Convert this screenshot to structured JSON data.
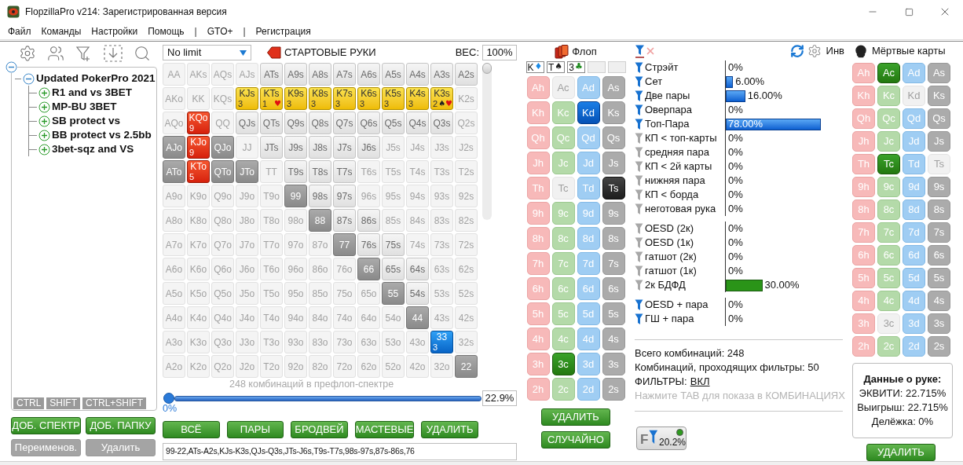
{
  "window": {
    "title": "FlopzillaPro v214: Зарегистрированная версия"
  },
  "menu": [
    {
      "label": "Файл",
      "kind": "item"
    },
    {
      "label": "Команды",
      "kind": "item"
    },
    {
      "label": "Настройки",
      "kind": "item"
    },
    {
      "label": "Помощь",
      "kind": "item"
    },
    {
      "label": "|",
      "kind": "separator"
    },
    {
      "label": "GTO+",
      "kind": "item"
    },
    {
      "label": "|",
      "kind": "separator"
    },
    {
      "label": "Регистрация",
      "kind": "item"
    }
  ],
  "tree": {
    "expanded": true,
    "children": [
      {
        "label": "Updated PokerPro 2021",
        "expanded": true,
        "children": [
          {
            "label": "R1 and vs 3BET",
            "expanded": false
          },
          {
            "label": "MP-BU 3BET",
            "expanded": false
          },
          {
            "label": "SB protect vs",
            "expanded": false
          },
          {
            "label": "BB protect vs 2.5bb",
            "expanded": false
          },
          {
            "label": "3bet-sqz and VS",
            "expanded": false
          }
        ]
      }
    ]
  },
  "modifier_tabs": [
    "CTRL",
    "SHIFT",
    "CTRL+SHIFT"
  ],
  "range_buttons": [
    {
      "label": "ДОБ. СПЕКТР",
      "disabled": false
    },
    {
      "label": "ДОБ. ПАПКУ",
      "disabled": false
    },
    {
      "label": "Переименов.",
      "disabled": true
    },
    {
      "label": "Удалить",
      "disabled": true
    }
  ],
  "range_editor": {
    "game": "No limit",
    "title": "СТАРТОВЫЕ РУКИ",
    "weight_label": "ВЕС:",
    "weight": "100%",
    "matrix": [
      [
        {
          "label": "AA",
          "kind": "off"
        },
        {
          "label": "AKs",
          "kind": "off"
        },
        {
          "label": "AQs",
          "kind": "off"
        },
        {
          "label": "AJs",
          "kind": "off"
        },
        {
          "label": "ATs",
          "kind": "on"
        },
        {
          "label": "A9s",
          "kind": "on"
        },
        {
          "label": "A8s",
          "kind": "on"
        },
        {
          "label": "A7s",
          "kind": "on"
        },
        {
          "label": "A6s",
          "kind": "on"
        },
        {
          "label": "A5s",
          "kind": "on"
        },
        {
          "label": "A4s",
          "kind": "on"
        },
        {
          "label": "A3s",
          "kind": "on"
        },
        {
          "label": "A2s",
          "kind": "on"
        }
      ],
      [
        {
          "label": "AKo",
          "kind": "off"
        },
        {
          "label": "KK",
          "kind": "off"
        },
        {
          "label": "KQs",
          "kind": "off"
        },
        {
          "label": "KJs",
          "kind": "yellow",
          "count": "3"
        },
        {
          "label": "KTs",
          "kind": "yellow",
          "count": "1",
          "marks": [
            {
              "symbol": "♥",
              "color": "#e01010"
            }
          ]
        },
        {
          "label": "K9s",
          "kind": "yellow",
          "count": "3"
        },
        {
          "label": "K8s",
          "kind": "yellow",
          "count": "3"
        },
        {
          "label": "K7s",
          "kind": "yellow",
          "count": "3"
        },
        {
          "label": "K6s",
          "kind": "yellow",
          "count": "3"
        },
        {
          "label": "K5s",
          "kind": "yellow",
          "count": "3"
        },
        {
          "label": "K4s",
          "kind": "yellow",
          "count": "3"
        },
        {
          "label": "K3s",
          "kind": "yellow",
          "count": "2",
          "marks": [
            {
              "symbol": "♠",
              "color": "#222222"
            },
            {
              "symbol": "♥",
              "color": "#e01010"
            }
          ]
        },
        {
          "label": "K2s",
          "kind": "off"
        }
      ],
      [
        {
          "label": "AQo",
          "kind": "off"
        },
        {
          "label": "KQo",
          "kind": "red",
          "count": "9"
        },
        {
          "label": "QQ",
          "kind": "off"
        },
        {
          "label": "QJs",
          "kind": "on"
        },
        {
          "label": "QTs",
          "kind": "on"
        },
        {
          "label": "Q9s",
          "kind": "on"
        },
        {
          "label": "Q8s",
          "kind": "on"
        },
        {
          "label": "Q7s",
          "kind": "on"
        },
        {
          "label": "Q6s",
          "kind": "on"
        },
        {
          "label": "Q5s",
          "kind": "on"
        },
        {
          "label": "Q4s",
          "kind": "on"
        },
        {
          "label": "Q3s",
          "kind": "on"
        },
        {
          "label": "Q2s",
          "kind": "off"
        }
      ],
      [
        {
          "label": "AJo",
          "kind": "dark"
        },
        {
          "label": "KJo",
          "kind": "red",
          "count": "9"
        },
        {
          "label": "QJo",
          "kind": "dark"
        },
        {
          "label": "JJ",
          "kind": "off"
        },
        {
          "label": "JTs",
          "kind": "on"
        },
        {
          "label": "J9s",
          "kind": "on"
        },
        {
          "label": "J8s",
          "kind": "on"
        },
        {
          "label": "J7s",
          "kind": "on"
        },
        {
          "label": "J6s",
          "kind": "on"
        },
        {
          "label": "J5s",
          "kind": "off"
        },
        {
          "label": "J4s",
          "kind": "off"
        },
        {
          "label": "J3s",
          "kind": "off"
        },
        {
          "label": "J2s",
          "kind": "off"
        }
      ],
      [
        {
          "label": "ATo",
          "kind": "dark"
        },
        {
          "label": "KTo",
          "kind": "red",
          "count": "5"
        },
        {
          "label": "QTo",
          "kind": "dark"
        },
        {
          "label": "JTo",
          "kind": "dark"
        },
        {
          "label": "TT",
          "kind": "off"
        },
        {
          "label": "T9s",
          "kind": "on"
        },
        {
          "label": "T8s",
          "kind": "on"
        },
        {
          "label": "T7s",
          "kind": "on"
        },
        {
          "label": "T6s",
          "kind": "off"
        },
        {
          "label": "T5s",
          "kind": "off"
        },
        {
          "label": "T4s",
          "kind": "off"
        },
        {
          "label": "T3s",
          "kind": "off"
        },
        {
          "label": "T2s",
          "kind": "off"
        }
      ],
      [
        {
          "label": "A9o",
          "kind": "off"
        },
        {
          "label": "K9o",
          "kind": "off"
        },
        {
          "label": "Q9o",
          "kind": "off"
        },
        {
          "label": "J9o",
          "kind": "off"
        },
        {
          "label": "T9o",
          "kind": "off"
        },
        {
          "label": "99",
          "kind": "dark"
        },
        {
          "label": "98s",
          "kind": "on"
        },
        {
          "label": "97s",
          "kind": "on"
        },
        {
          "label": "96s",
          "kind": "off"
        },
        {
          "label": "95s",
          "kind": "off"
        },
        {
          "label": "94s",
          "kind": "off"
        },
        {
          "label": "93s",
          "kind": "off"
        },
        {
          "label": "92s",
          "kind": "off"
        }
      ],
      [
        {
          "label": "A8o",
          "kind": "off"
        },
        {
          "label": "K8o",
          "kind": "off"
        },
        {
          "label": "Q8o",
          "kind": "off"
        },
        {
          "label": "J8o",
          "kind": "off"
        },
        {
          "label": "T8o",
          "kind": "off"
        },
        {
          "label": "98o",
          "kind": "off"
        },
        {
          "label": "88",
          "kind": "dark"
        },
        {
          "label": "87s",
          "kind": "on"
        },
        {
          "label": "86s",
          "kind": "on"
        },
        {
          "label": "85s",
          "kind": "off"
        },
        {
          "label": "84s",
          "kind": "off"
        },
        {
          "label": "83s",
          "kind": "off"
        },
        {
          "label": "82s",
          "kind": "off"
        }
      ],
      [
        {
          "label": "A7o",
          "kind": "off"
        },
        {
          "label": "K7o",
          "kind": "off"
        },
        {
          "label": "Q7o",
          "kind": "off"
        },
        {
          "label": "J7o",
          "kind": "off"
        },
        {
          "label": "T7o",
          "kind": "off"
        },
        {
          "label": "97o",
          "kind": "off"
        },
        {
          "label": "87o",
          "kind": "off"
        },
        {
          "label": "77",
          "kind": "dark"
        },
        {
          "label": "76s",
          "kind": "on"
        },
        {
          "label": "75s",
          "kind": "on"
        },
        {
          "label": "74s",
          "kind": "off"
        },
        {
          "label": "73s",
          "kind": "off"
        },
        {
          "label": "72s",
          "kind": "off"
        }
      ],
      [
        {
          "label": "A6o",
          "kind": "off"
        },
        {
          "label": "K6o",
          "kind": "off"
        },
        {
          "label": "Q6o",
          "kind": "off"
        },
        {
          "label": "J6o",
          "kind": "off"
        },
        {
          "label": "T6o",
          "kind": "off"
        },
        {
          "label": "96o",
          "kind": "off"
        },
        {
          "label": "86o",
          "kind": "off"
        },
        {
          "label": "76o",
          "kind": "off"
        },
        {
          "label": "66",
          "kind": "dark"
        },
        {
          "label": "65s",
          "kind": "on"
        },
        {
          "label": "64s",
          "kind": "on"
        },
        {
          "label": "63s",
          "kind": "off"
        },
        {
          "label": "62s",
          "kind": "off"
        }
      ],
      [
        {
          "label": "A5o",
          "kind": "off"
        },
        {
          "label": "K5o",
          "kind": "off"
        },
        {
          "label": "Q5o",
          "kind": "off"
        },
        {
          "label": "J5o",
          "kind": "off"
        },
        {
          "label": "T5o",
          "kind": "off"
        },
        {
          "label": "95o",
          "kind": "off"
        },
        {
          "label": "85o",
          "kind": "off"
        },
        {
          "label": "75o",
          "kind": "off"
        },
        {
          "label": "65o",
          "kind": "off"
        },
        {
          "label": "55",
          "kind": "dark"
        },
        {
          "label": "54s",
          "kind": "on"
        },
        {
          "label": "53s",
          "kind": "off"
        },
        {
          "label": "52s",
          "kind": "off"
        }
      ],
      [
        {
          "label": "A4o",
          "kind": "off"
        },
        {
          "label": "K4o",
          "kind": "off"
        },
        {
          "label": "Q4o",
          "kind": "off"
        },
        {
          "label": "J4o",
          "kind": "off"
        },
        {
          "label": "T4o",
          "kind": "off"
        },
        {
          "label": "94o",
          "kind": "off"
        },
        {
          "label": "84o",
          "kind": "off"
        },
        {
          "label": "74o",
          "kind": "off"
        },
        {
          "label": "64o",
          "kind": "off"
        },
        {
          "label": "54o",
          "kind": "off"
        },
        {
          "label": "44",
          "kind": "dark"
        },
        {
          "label": "43s",
          "kind": "off"
        },
        {
          "label": "42s",
          "kind": "off"
        }
      ],
      [
        {
          "label": "A3o",
          "kind": "off"
        },
        {
          "label": "K3o",
          "kind": "off"
        },
        {
          "label": "Q3o",
          "kind": "off"
        },
        {
          "label": "J3o",
          "kind": "off"
        },
        {
          "label": "T3o",
          "kind": "off"
        },
        {
          "label": "93o",
          "kind": "off"
        },
        {
          "label": "83o",
          "kind": "off"
        },
        {
          "label": "73o",
          "kind": "off"
        },
        {
          "label": "63o",
          "kind": "off"
        },
        {
          "label": "53o",
          "kind": "off"
        },
        {
          "label": "43o",
          "kind": "off"
        },
        {
          "label": "33",
          "kind": "blue",
          "count": "3"
        },
        {
          "label": "32s",
          "kind": "off"
        }
      ],
      [
        {
          "label": "A2o",
          "kind": "off"
        },
        {
          "label": "K2o",
          "kind": "off"
        },
        {
          "label": "Q2o",
          "kind": "off"
        },
        {
          "label": "J2o",
          "kind": "off"
        },
        {
          "label": "T2o",
          "kind": "off"
        },
        {
          "label": "92o",
          "kind": "off"
        },
        {
          "label": "82o",
          "kind": "off"
        },
        {
          "label": "72o",
          "kind": "off"
        },
        {
          "label": "62o",
          "kind": "off"
        },
        {
          "label": "52o",
          "kind": "off"
        },
        {
          "label": "42o",
          "kind": "off"
        },
        {
          "label": "32o",
          "kind": "off"
        },
        {
          "label": "22",
          "kind": "dark"
        }
      ]
    ],
    "weight_slider": {
      "level": 1
    },
    "range_slider": {
      "level": 0
    },
    "combos_caption": "248 комбинаций в префлоп-спектре",
    "slider_min": "0%",
    "slider_value": "22.9%",
    "buttons": [
      "ВСЁ",
      "ПАРЫ",
      "БРОДВЕЙ",
      "МАСТЕВЫЕ",
      "УДАЛИТЬ"
    ],
    "range_text": "99-22,ATs-A2s,KJs-K3s,QJs-Q3s,JTs-J6s,T9s-T7s,98s-97s,87s-86s,76"
  },
  "flop": {
    "title": "Флоп",
    "board": [
      {
        "kind": "card",
        "rank": "K",
        "suit": "♦",
        "color": "#1a8ae6"
      },
      {
        "kind": "card",
        "rank": "T",
        "suit": "♠",
        "color": "#222222"
      },
      {
        "kind": "card",
        "rank": "3",
        "suit": "♣",
        "color": "#1e8a1e"
      },
      {
        "kind": "empty"
      },
      {
        "kind": "empty"
      }
    ],
    "cards": [
      [
        {
          "label": "Ah",
          "selected": false,
          "disabled": false
        },
        {
          "label": "Ac",
          "selected": false,
          "disabled": true
        },
        {
          "label": "Ad",
          "selected": false,
          "disabled": false
        },
        {
          "label": "As",
          "selected": false,
          "disabled": false
        }
      ],
      [
        {
          "label": "Kh",
          "selected": false,
          "disabled": false
        },
        {
          "label": "Kc",
          "selected": false,
          "disabled": false
        },
        {
          "label": "Kd",
          "selected": true,
          "disabled": false
        },
        {
          "label": "Ks",
          "selected": false,
          "disabled": false
        }
      ],
      [
        {
          "label": "Qh",
          "selected": false,
          "disabled": false
        },
        {
          "label": "Qc",
          "selected": false,
          "disabled": false
        },
        {
          "label": "Qd",
          "selected": false,
          "disabled": false
        },
        {
          "label": "Qs",
          "selected": false,
          "disabled": false
        }
      ],
      [
        {
          "label": "Jh",
          "selected": false,
          "disabled": false
        },
        {
          "label": "Jc",
          "selected": false,
          "disabled": false
        },
        {
          "label": "Jd",
          "selected": false,
          "disabled": false
        },
        {
          "label": "Js",
          "selected": false,
          "disabled": false
        }
      ],
      [
        {
          "label": "Th",
          "selected": false,
          "disabled": false
        },
        {
          "label": "Tc",
          "selected": false,
          "disabled": true
        },
        {
          "label": "Td",
          "selected": false,
          "disabled": false
        },
        {
          "label": "Ts",
          "selected": true,
          "disabled": false
        }
      ],
      [
        {
          "label": "9h",
          "selected": false,
          "disabled": false
        },
        {
          "label": "9c",
          "selected": false,
          "disabled": false
        },
        {
          "label": "9d",
          "selected": false,
          "disabled": false
        },
        {
          "label": "9s",
          "selected": false,
          "disabled": false
        }
      ],
      [
        {
          "label": "8h",
          "selected": false,
          "disabled": false
        },
        {
          "label": "8c",
          "selected": false,
          "disabled": false
        },
        {
          "label": "8d",
          "selected": false,
          "disabled": false
        },
        {
          "label": "8s",
          "selected": false,
          "disabled": false
        }
      ],
      [
        {
          "label": "7h",
          "selected": false,
          "disabled": false
        },
        {
          "label": "7c",
          "selected": false,
          "disabled": false
        },
        {
          "label": "7d",
          "selected": false,
          "disabled": false
        },
        {
          "label": "7s",
          "selected": false,
          "disabled": false
        }
      ],
      [
        {
          "label": "6h",
          "selected": false,
          "disabled": false
        },
        {
          "label": "6c",
          "selected": false,
          "disabled": false
        },
        {
          "label": "6d",
          "selected": false,
          "disabled": false
        },
        {
          "label": "6s",
          "selected": false,
          "disabled": false
        }
      ],
      [
        {
          "label": "5h",
          "selected": false,
          "disabled": false
        },
        {
          "label": "5c",
          "selected": false,
          "disabled": false
        },
        {
          "label": "5d",
          "selected": false,
          "disabled": false
        },
        {
          "label": "5s",
          "selected": false,
          "disabled": false
        }
      ],
      [
        {
          "label": "4h",
          "selected": false,
          "disabled": false
        },
        {
          "label": "4c",
          "selected": false,
          "disabled": false
        },
        {
          "label": "4d",
          "selected": false,
          "disabled": false
        },
        {
          "label": "4s",
          "selected": false,
          "disabled": false
        }
      ],
      [
        {
          "label": "3h",
          "selected": false,
          "disabled": false
        },
        {
          "label": "3c",
          "selected": true,
          "disabled": false
        },
        {
          "label": "3d",
          "selected": false,
          "disabled": false
        },
        {
          "label": "3s",
          "selected": false,
          "disabled": false
        }
      ],
      [
        {
          "label": "2h",
          "selected": false,
          "disabled": false
        },
        {
          "label": "2c",
          "selected": false,
          "disabled": false
        },
        {
          "label": "2d",
          "selected": false,
          "disabled": false
        },
        {
          "label": "2s",
          "selected": false,
          "disabled": false
        }
      ]
    ],
    "buttons": [
      "УДАЛИТЬ",
      "СЛУЧАЙНО"
    ]
  },
  "stats": {
    "invert_label": "Инв",
    "groups": [
      {
        "kind": "made",
        "items": [
          {
            "label": "Стрэйт",
            "active": true,
            "reading": "0%"
          },
          {
            "label": "Сет",
            "active": true,
            "level": 0.06,
            "reading": "6.00%"
          },
          {
            "label": "Две пары",
            "active": true,
            "level": 0.16,
            "reading": "16.00%"
          },
          {
            "label": "Оверпара",
            "active": true,
            "reading": "0%"
          },
          {
            "label": "Топ-Пара",
            "active": true,
            "level": 0.78,
            "reading": "78.00%"
          },
          {
            "label": "КП < топ-карты",
            "active": false,
            "reading": "0%"
          },
          {
            "label": "средняя пара",
            "active": false,
            "reading": "0%"
          },
          {
            "label": "КП < 2й карты",
            "active": false,
            "reading": "0%"
          },
          {
            "label": "нижняя пара",
            "active": false,
            "reading": "0%"
          },
          {
            "label": "КП < борда",
            "active": false,
            "reading": "0%"
          },
          {
            "label": "неготовая рука",
            "active": false,
            "reading": "0%"
          }
        ]
      },
      {
        "kind": "draw",
        "items": [
          {
            "label": "OESD (2к)",
            "active": false,
            "reading": "0%"
          },
          {
            "label": "OESD (1к)",
            "active": false,
            "reading": "0%"
          },
          {
            "label": "гатшот (2к)",
            "active": false,
            "reading": "0%"
          },
          {
            "label": "гатшот (1к)",
            "active": false,
            "reading": "0%"
          },
          {
            "label": "2к БДФД",
            "active": false,
            "level": 0.3,
            "reading": "30.00%"
          }
        ]
      },
      {
        "kind": "made",
        "items": [
          {
            "label": "OESD + пара",
            "active": true,
            "reading": "0%"
          },
          {
            "label": "ГШ + пара",
            "active": true,
            "reading": "0%"
          }
        ]
      }
    ],
    "total": "Всего комбинаций: 248",
    "passing": "Комбинаций, проходящих фильтры: 50",
    "filters_label": "ФИЛЬТРЫ:",
    "filters_link": "ВКЛ",
    "hint": "Нажмите TAB для показа в КОМБИНАЦИЯХ",
    "filter_button": {
      "letter": "F",
      "value": "20.2%"
    }
  },
  "dead_cards": {
    "title": "Мёртвые карты",
    "cards": [
      [
        {
          "label": "Ah",
          "selected": false,
          "disabled": false
        },
        {
          "label": "Ac",
          "selected": true,
          "disabled": false
        },
        {
          "label": "Ad",
          "selected": false,
          "disabled": false
        },
        {
          "label": "As",
          "selected": false,
          "disabled": false
        }
      ],
      [
        {
          "label": "Kh",
          "selected": false,
          "disabled": false
        },
        {
          "label": "Kc",
          "selected": false,
          "disabled": false
        },
        {
          "label": "Kd",
          "selected": false,
          "disabled": true
        },
        {
          "label": "Ks",
          "selected": false,
          "disabled": false
        }
      ],
      [
        {
          "label": "Qh",
          "selected": false,
          "disabled": false
        },
        {
          "label": "Qc",
          "selected": false,
          "disabled": false
        },
        {
          "label": "Qd",
          "selected": false,
          "disabled": false
        },
        {
          "label": "Qs",
          "selected": false,
          "disabled": false
        }
      ],
      [
        {
          "label": "Jh",
          "selected": false,
          "disabled": false
        },
        {
          "label": "Jc",
          "selected": false,
          "disabled": false
        },
        {
          "label": "Jd",
          "selected": false,
          "disabled": false
        },
        {
          "label": "Js",
          "selected": false,
          "disabled": false
        }
      ],
      [
        {
          "label": "Th",
          "selected": false,
          "disabled": false
        },
        {
          "label": "Tc",
          "selected": true,
          "disabled": false
        },
        {
          "label": "Td",
          "selected": false,
          "disabled": false
        },
        {
          "label": "Ts",
          "selected": false,
          "disabled": true
        }
      ],
      [
        {
          "label": "9h",
          "selected": false,
          "disabled": false
        },
        {
          "label": "9c",
          "selected": false,
          "disabled": false
        },
        {
          "label": "9d",
          "selected": false,
          "disabled": false
        },
        {
          "label": "9s",
          "selected": false,
          "disabled": false
        }
      ],
      [
        {
          "label": "8h",
          "selected": false,
          "disabled": false
        },
        {
          "label": "8c",
          "selected": false,
          "disabled": false
        },
        {
          "label": "8d",
          "selected": false,
          "disabled": false
        },
        {
          "label": "8s",
          "selected": false,
          "disabled": false
        }
      ],
      [
        {
          "label": "7h",
          "selected": false,
          "disabled": false
        },
        {
          "label": "7c",
          "selected": false,
          "disabled": false
        },
        {
          "label": "7d",
          "selected": false,
          "disabled": false
        },
        {
          "label": "7s",
          "selected": false,
          "disabled": false
        }
      ],
      [
        {
          "label": "6h",
          "selected": false,
          "disabled": false
        },
        {
          "label": "6c",
          "selected": false,
          "disabled": false
        },
        {
          "label": "6d",
          "selected": false,
          "disabled": false
        },
        {
          "label": "6s",
          "selected": false,
          "disabled": false
        }
      ],
      [
        {
          "label": "5h",
          "selected": false,
          "disabled": false
        },
        {
          "label": "5c",
          "selected": false,
          "disabled": false
        },
        {
          "label": "5d",
          "selected": false,
          "disabled": false
        },
        {
          "label": "5s",
          "selected": false,
          "disabled": false
        }
      ],
      [
        {
          "label": "4h",
          "selected": false,
          "disabled": false
        },
        {
          "label": "4c",
          "selected": false,
          "disabled": false
        },
        {
          "label": "4d",
          "selected": false,
          "disabled": false
        },
        {
          "label": "4s",
          "selected": false,
          "disabled": false
        }
      ],
      [
        {
          "label": "3h",
          "selected": false,
          "disabled": false
        },
        {
          "label": "3c",
          "selected": false,
          "disabled": true
        },
        {
          "label": "3d",
          "selected": false,
          "disabled": false
        },
        {
          "label": "3s",
          "selected": false,
          "disabled": false
        }
      ],
      [
        {
          "label": "2h",
          "selected": false,
          "disabled": false
        },
        {
          "label": "2c",
          "selected": false,
          "disabled": false
        },
        {
          "label": "2d",
          "selected": false,
          "disabled": false
        },
        {
          "label": "2s",
          "selected": false,
          "disabled": false
        }
      ]
    ],
    "hand_info": {
      "title": "Данные о руке:",
      "lines": [
        "ЭКВИТИ: 22.715%",
        "Выигрыш: 22.715%",
        "Делёжка: 0%"
      ]
    },
    "button": "УДАЛИТЬ"
  }
}
